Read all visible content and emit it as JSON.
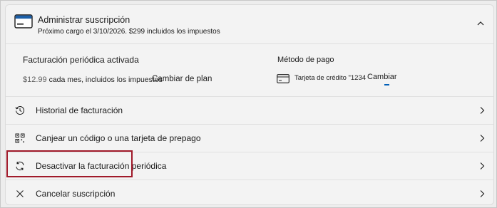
{
  "header": {
    "title": "Administrar suscripción",
    "subtitle": "Próximo cargo el 3/10/2026. $299 incluidos los impuestos",
    "icon": "credit-card-icon",
    "collapse_icon": "chevron-up-icon"
  },
  "billing": {
    "title": "Facturación periódica activada",
    "price": "$12.99",
    "price_detail": " cada mes, incluidos los impuestos",
    "change_plan": "Cambiar de plan"
  },
  "payment_method": {
    "title": "Método de pago",
    "card_text": "Tarjeta de crédito \"1234",
    "change": "Cambiar"
  },
  "rows": [
    {
      "label": "Historial de facturación",
      "icon": "history-icon"
    },
    {
      "label": "Canjear un código o una tarjeta de prepago",
      "icon": "qr-code-icon"
    },
    {
      "label": "Desactivar la facturación periódica",
      "icon": "refresh-icon",
      "highlighted": true
    },
    {
      "label": "Cancelar suscripción",
      "icon": "close-icon"
    }
  ],
  "colors": {
    "highlight": "#a01a2a",
    "accent": "#005fb8"
  }
}
